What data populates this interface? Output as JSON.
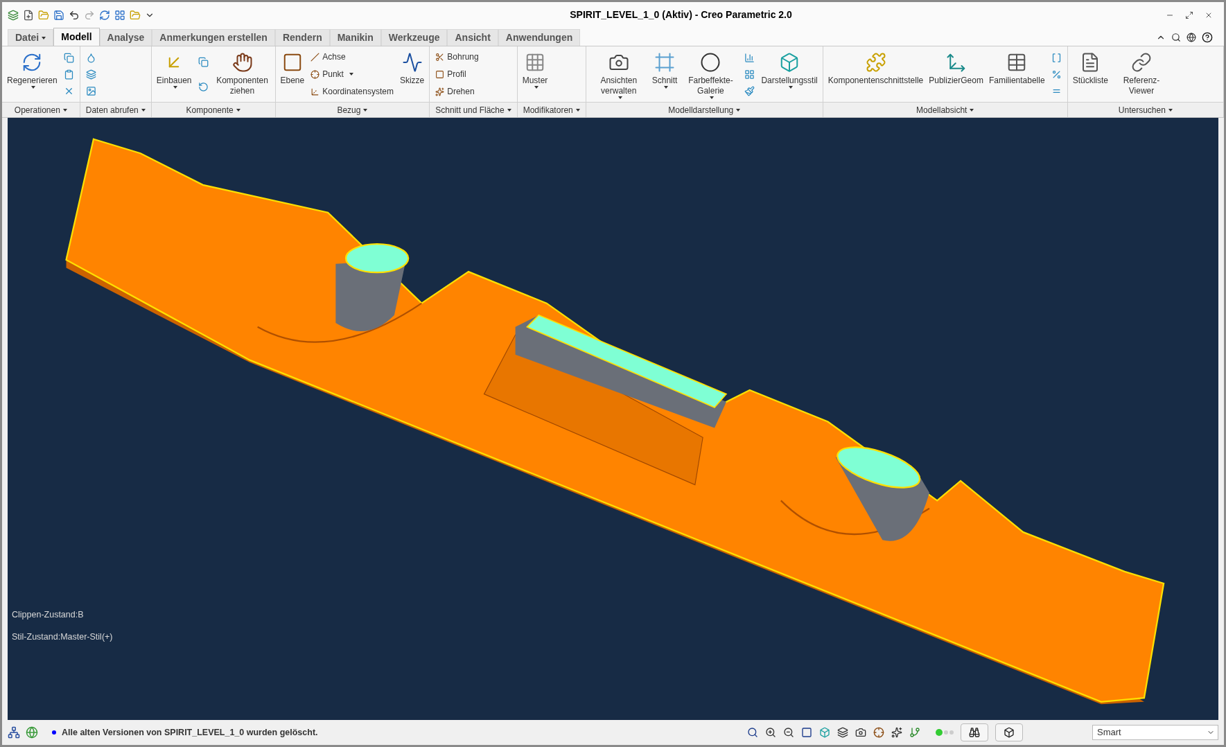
{
  "window": {
    "title": "SPIRIT_LEVEL_1_0 (Aktiv) - Creo Parametric 2.0"
  },
  "tabs": [
    {
      "label": "Datei",
      "selected": false,
      "kind": "menu"
    },
    {
      "label": "Modell",
      "selected": true,
      "kind": "tab"
    },
    {
      "label": "Analyse",
      "selected": false,
      "kind": "tab"
    },
    {
      "label": "Anmerkungen erstellen",
      "selected": false,
      "kind": "tab"
    },
    {
      "label": "Rendern",
      "selected": false,
      "kind": "tab"
    },
    {
      "label": "Manikin",
      "selected": false,
      "kind": "tab"
    },
    {
      "label": "Werkzeuge",
      "selected": false,
      "kind": "tab"
    },
    {
      "label": "Ansicht",
      "selected": false,
      "kind": "tab"
    },
    {
      "label": "Anwendungen",
      "selected": false,
      "kind": "tab"
    }
  ],
  "ribbon_groups": [
    {
      "label": "Operationen",
      "items": [
        {
          "kind": "large",
          "label": "Regenerieren",
          "menu": true
        },
        {
          "kind": "icon_stack"
        }
      ]
    },
    {
      "label": "Daten abrufen",
      "items": [
        {
          "kind": "icon_stack"
        }
      ]
    },
    {
      "label": "Komponente",
      "items": [
        {
          "kind": "large",
          "label": "Einbauen",
          "menu": true
        },
        {
          "kind": "icon_stack"
        },
        {
          "kind": "large",
          "label": "Komponenten ziehen",
          "menu": false
        }
      ]
    },
    {
      "label": "Bezug",
      "items": [
        {
          "kind": "large",
          "label": "Ebene",
          "menu": false
        },
        {
          "kind": "stack",
          "entries": [
            {
              "label": "Achse",
              "menu": false
            },
            {
              "label": "Punkt",
              "menu": true
            },
            {
              "label": "Koordinatensystem",
              "menu": false
            }
          ]
        },
        {
          "kind": "large",
          "label": "Skizze",
          "menu": false
        }
      ]
    },
    {
      "label": "Schnitt und Fläche",
      "items": [
        {
          "kind": "stack",
          "entries": [
            {
              "label": "Bohrung",
              "menu": false
            },
            {
              "label": "Profil",
              "menu": false
            },
            {
              "label": "Drehen",
              "menu": false
            }
          ]
        }
      ]
    },
    {
      "label": "Modifikatoren",
      "items": [
        {
          "kind": "large",
          "label": "Muster",
          "menu": true
        }
      ]
    },
    {
      "label": "Modelldarstellung",
      "items": [
        {
          "kind": "large",
          "label": "Ansichten verwalten",
          "menu": true
        },
        {
          "kind": "large",
          "label": "Schnitt",
          "menu": true
        },
        {
          "kind": "large",
          "label": "Farbeffekte-Galerie",
          "menu": true
        },
        {
          "kind": "icon_stack"
        },
        {
          "kind": "large",
          "label": "Darstellungsstil",
          "menu": true
        }
      ]
    },
    {
      "label": "Modellabsicht",
      "items": [
        {
          "kind": "large",
          "label": "Komponentenschnittstelle",
          "menu": false
        },
        {
          "kind": "large",
          "label": "PublizierGeom",
          "menu": false
        },
        {
          "kind": "large",
          "label": "Familientabelle",
          "menu": false
        },
        {
          "kind": "icon_stack"
        }
      ]
    },
    {
      "label": "Untersuchen",
      "items": [
        {
          "kind": "large",
          "label": "Stückliste",
          "menu": false
        },
        {
          "kind": "large",
          "label": "Referenz-Viewer",
          "menu": false
        }
      ]
    }
  ],
  "viewport": {
    "overlay_lines": [
      "Clippen-Zustand:B",
      "Stil-Zustand:Master-Stil(+)"
    ]
  },
  "status_bar": {
    "message": "Alle alten Versionen von SPIRIT_LEVEL_1_0 wurden gelöscht.",
    "filter": "Smart"
  }
}
